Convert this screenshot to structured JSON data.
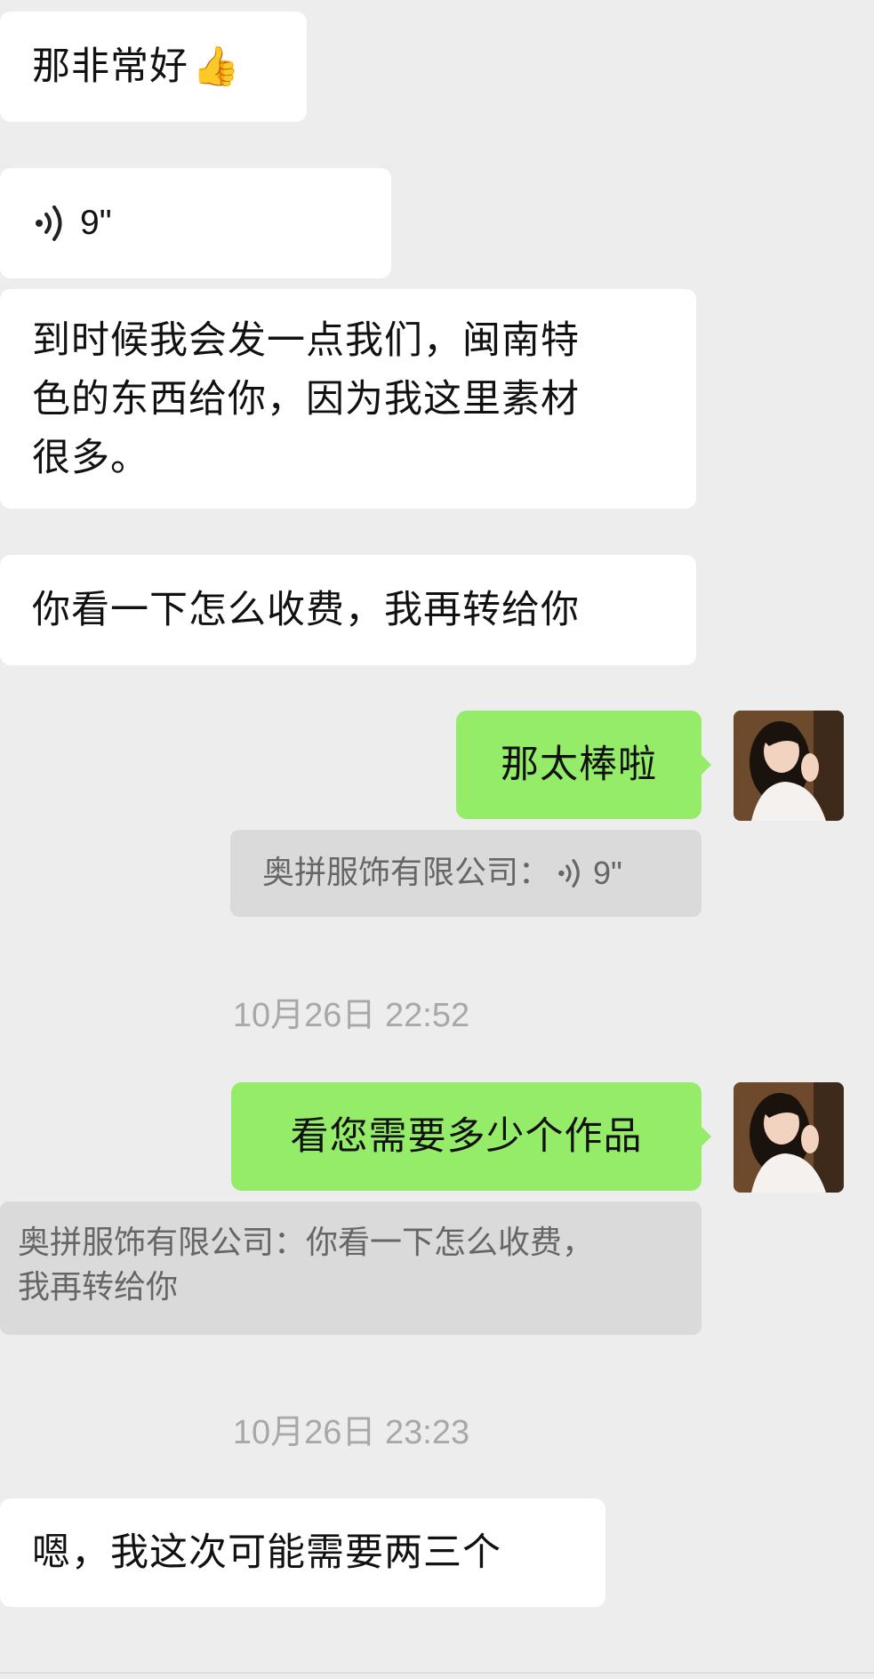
{
  "messages": {
    "m1": {
      "text": "那非常好",
      "emoji": "👍"
    },
    "m2": {
      "duration": "9\""
    },
    "m3": {
      "lines": [
        "到时候我会发一点我们，闽南特",
        "色的东西给你，因为我这里素材",
        "很多。"
      ]
    },
    "m4": {
      "text": "你看一下怎么收费，我再转给你"
    },
    "m5": {
      "text": "那太棒啦"
    },
    "m5_quote": {
      "sender": "奥拼服饰有限公司：",
      "duration": "9\""
    },
    "ts1": {
      "text": "10月26日 22:52"
    },
    "m6": {
      "text": "看您需要多少个作品"
    },
    "m6_quote": {
      "lines": [
        "奥拼服饰有限公司：你看一下怎么收费，",
        "我再转给你"
      ]
    },
    "ts2": {
      "text": "10月26日 23:23"
    },
    "m7": {
      "text": "嗯，我这次可能需要两三个"
    }
  },
  "colors": {
    "background": "#ededed",
    "incoming_bubble": "#ffffff",
    "outgoing_bubble": "#95ec69",
    "quote_bg": "#dadada",
    "timestamp": "#a8a8a8"
  },
  "icons": {
    "voice": "voice-wave-icon",
    "avatar": "user-avatar-photo"
  }
}
